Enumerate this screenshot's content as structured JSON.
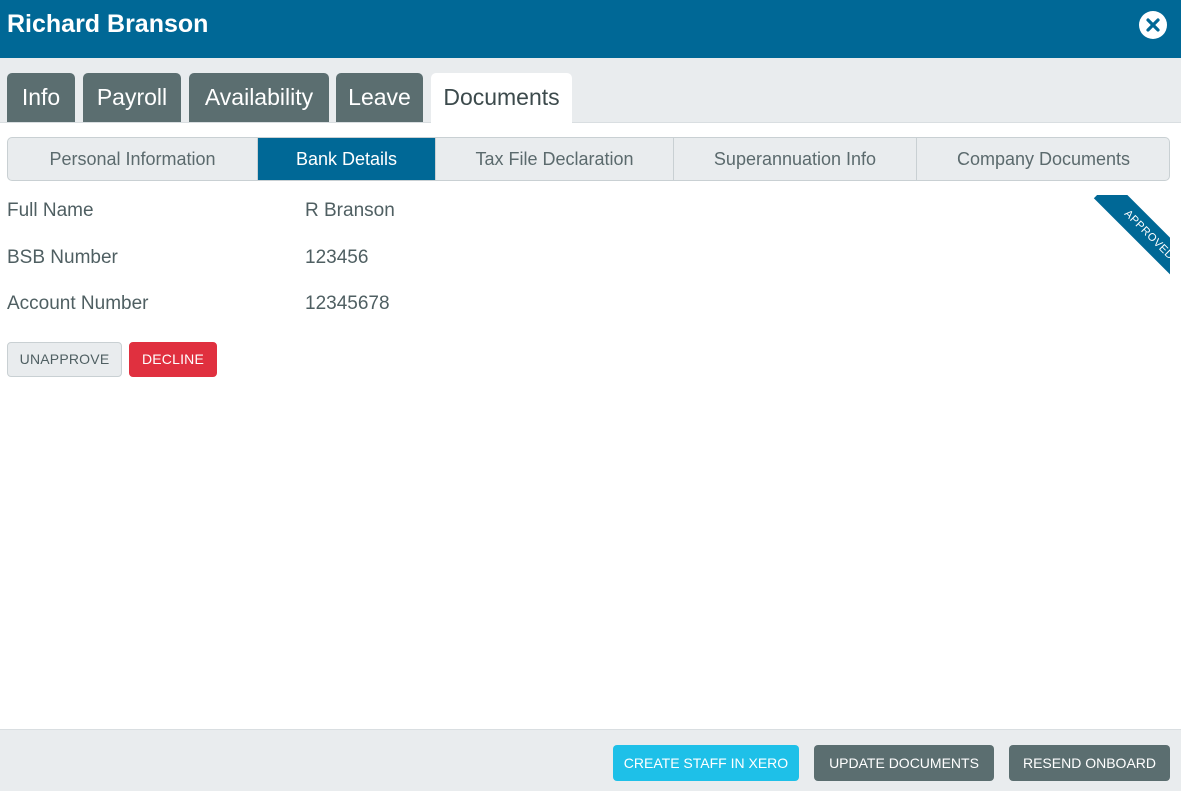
{
  "header": {
    "title": "Richard Branson",
    "close_icon": "close-icon"
  },
  "tabs": [
    {
      "label": "Info",
      "active": false
    },
    {
      "label": "Payroll",
      "active": false
    },
    {
      "label": "Availability",
      "active": false
    },
    {
      "label": "Leave",
      "active": false
    },
    {
      "label": "Documents",
      "active": true
    }
  ],
  "subtabs": [
    {
      "label": "Personal Information",
      "active": false
    },
    {
      "label": "Bank Details",
      "active": true
    },
    {
      "label": "Tax File Declaration",
      "active": false
    },
    {
      "label": "Superannuation Info",
      "active": false
    },
    {
      "label": "Company Documents",
      "active": false
    }
  ],
  "bank_details": {
    "fields": [
      {
        "label": "Full Name",
        "value": "R Branson"
      },
      {
        "label": "BSB Number",
        "value": "123456"
      },
      {
        "label": "Account Number",
        "value": "12345678"
      }
    ],
    "status_ribbon": "APPROVED",
    "unapprove_label": "UNAPPROVE",
    "decline_label": "DECLINE"
  },
  "footer": {
    "create_staff_label": "CREATE STAFF IN XERO",
    "update_documents_label": "UPDATE DOCUMENTS",
    "resend_onboard_label": "RESEND ONBOARD"
  },
  "colors": {
    "brand": "#006896",
    "tab_inactive": "#5b6e70",
    "decline": "#e0303f",
    "xero": "#1ec0e8"
  }
}
